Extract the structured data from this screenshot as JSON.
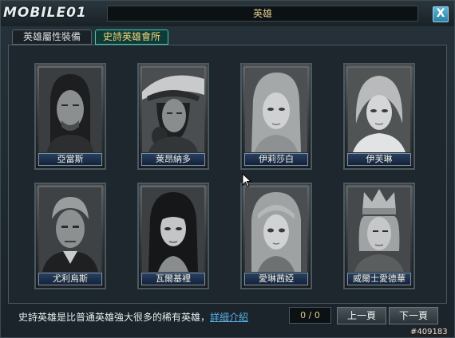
{
  "header": {
    "logo_text": "MOBILE01",
    "title": "英雄",
    "close_label": "X"
  },
  "tabs": [
    {
      "label": "英雄屬性裝備",
      "active": false
    },
    {
      "label": "史詩英雄會所",
      "active": true
    }
  ],
  "heroes": [
    {
      "name": "亞當斯",
      "icon": "portrait-long-hair-man"
    },
    {
      "name": "萊昂納多",
      "icon": "portrait-feather-hat-man"
    },
    {
      "name": "伊莉莎白",
      "icon": "portrait-blonde-woman"
    },
    {
      "name": "伊芙琳",
      "icon": "portrait-short-hair-woman"
    },
    {
      "name": "尤利烏斯",
      "icon": "portrait-old-man"
    },
    {
      "name": "瓦爾基裡",
      "icon": "portrait-dark-hair-woman"
    },
    {
      "name": "愛琳茜婭",
      "icon": "portrait-girl"
    },
    {
      "name": "威爾士愛德華",
      "icon": "portrait-crowned-man"
    }
  ],
  "footer": {
    "info_text": "史詩英雄是比普通英雄強大很多的稀有英雄，",
    "info_link": "詳細介紹",
    "page_counter": "0 / 0",
    "prev_label": "上一頁",
    "next_label": "下一頁"
  },
  "watermark": "#409183",
  "colors": {
    "accent_tab": "#3ecab4",
    "title_text": "#e2c98a",
    "link": "#5ab0ec"
  }
}
